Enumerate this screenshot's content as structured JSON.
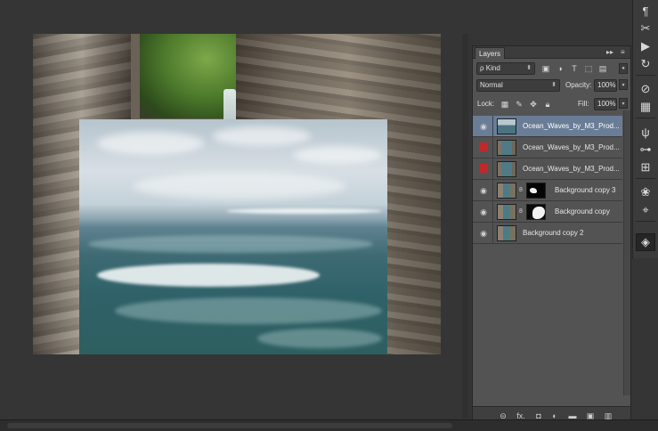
{
  "panel": {
    "tab_label": "Layers",
    "collapse_glyph": "▸▸",
    "menu_glyph": "≡",
    "close_glyph": "×",
    "filter_kind": "Kind",
    "blend_mode": "Normal",
    "opacity_label": "Opacity:",
    "opacity_value": "100%",
    "lock_label": "Lock:",
    "fill_label": "Fill:",
    "fill_value": "100%"
  },
  "layers": [
    {
      "name": "Ocean_Waves_by_M3_Prod...",
      "visible": true,
      "selected": true
    },
    {
      "name": "Ocean_Waves_by_M3_Prod...",
      "visible": false,
      "selected": false
    },
    {
      "name": "Ocean_Waves_by_M3_Prod...",
      "visible": false,
      "selected": false
    },
    {
      "name": "Background copy 3",
      "visible": true,
      "selected": false
    },
    {
      "name": "Background copy",
      "visible": true,
      "selected": false
    },
    {
      "name": "Background copy 2",
      "visible": true,
      "selected": false
    }
  ],
  "icons": {
    "eye": "◉",
    "chain": "8",
    "search": "ρ",
    "footer_link": "⊝",
    "footer_fx": "fx.",
    "footer_mask": "◘",
    "footer_adjust": "◐",
    "footer_group": "▬",
    "footer_new": "▣",
    "footer_trash": "▥"
  },
  "colors": {
    "panel_bg": "#535353",
    "selected_row": "#6a7d97",
    "hidden_marker": "#c0282a",
    "workspace": "#353535"
  }
}
